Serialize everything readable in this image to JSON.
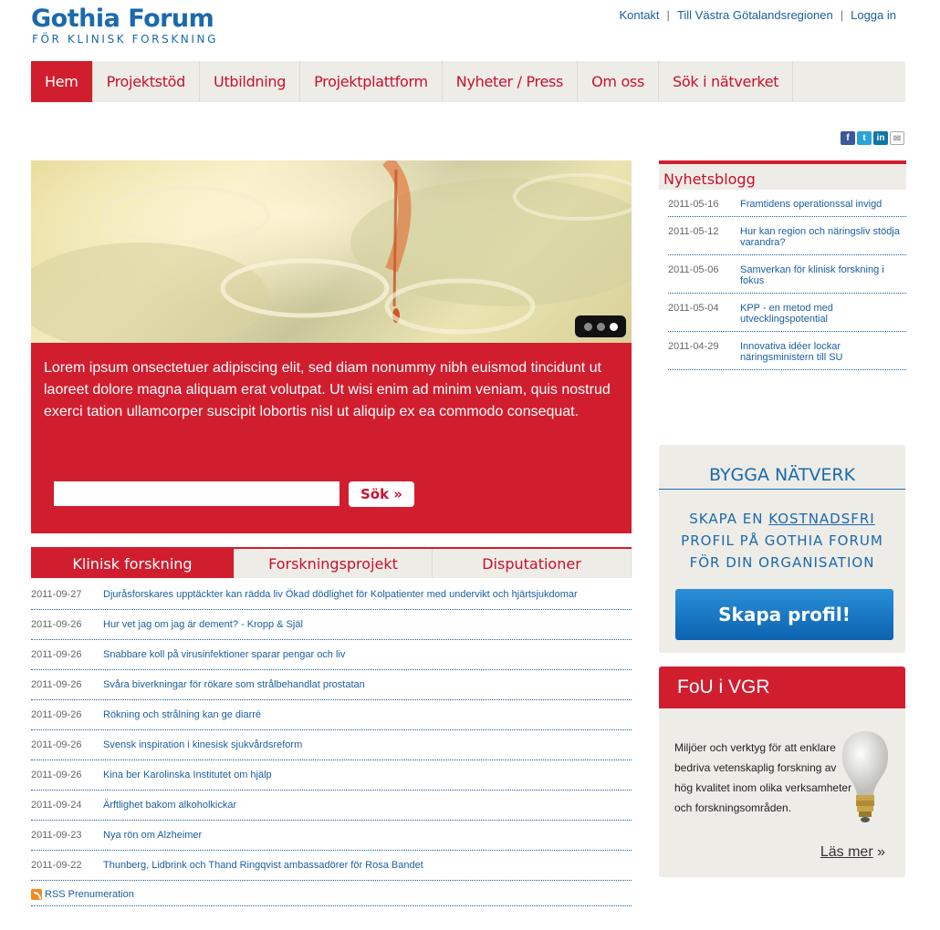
{
  "header": {
    "logo_main": "Gothia Forum",
    "logo_sub": "FÖR KLINISK FORSKNING",
    "links": [
      "Kontakt",
      "Till Västra Götalandsregionen",
      "Logga in"
    ]
  },
  "nav": [
    "Hem",
    "Projektstöd",
    "Utbildning",
    "Projektplattform",
    "Nyheter / Press",
    "Om oss",
    "Sök i nätverket"
  ],
  "social": [
    "facebook-icon",
    "twitter-icon",
    "linkedin-icon",
    "mail-icon"
  ],
  "hero": {
    "text": "Lorem ipsum onsectetuer adipiscing elit, sed diam nonummy nibh euismod tincidunt ut laoreet dolore magna aliquam erat volutpat. Ut wisi enim ad minim veniam, quis nostrud exerci tation ullamcorper suscipit lobortis nisl ut aliquip ex ea commodo consequat.",
    "search_placeholder": "",
    "search_button": "Sök »",
    "slides": 3,
    "active_slide": 3
  },
  "tabs": [
    "Klinisk forskning",
    "Forskningsprojekt",
    "Disputationer"
  ],
  "news": [
    {
      "date": "2011-09-27",
      "title": "Djuråsforskares upptäckter kan rädda liv Ökad dödlighet för Kolpatienter med undervikt och hjärtsjukdomar"
    },
    {
      "date": "2011-09-26",
      "title": "Hur vet jag om jag är dement? - Kropp & Själ"
    },
    {
      "date": "2011-09-26",
      "title": "Snabbare koll på virusinfektioner sparar pengar och liv"
    },
    {
      "date": "2011-09-26",
      "title": "Svåra biverkningar för rökare som strålbehandlat prostatan"
    },
    {
      "date": "2011-09-26",
      "title": "Rökning och strålning kan ge diarré"
    },
    {
      "date": "2011-09-26",
      "title": "Svensk inspiration i kinesisk sjukvårdsreform"
    },
    {
      "date": "2011-09-26",
      "title": "Kina ber Karolinska Institutet om hjälp"
    },
    {
      "date": "2011-09-24",
      "title": "Ärftlighet bakom alkoholkickar"
    },
    {
      "date": "2011-09-23",
      "title": "Nya rön om Alzheimer"
    },
    {
      "date": "2011-09-22",
      "title": "Thunberg, Lidbrink och Thand Ringqvist ambassadörer för Rosa Bandet"
    }
  ],
  "rss_label": "RSS Prenumeration",
  "blog": {
    "title": "Nyhetsblogg",
    "items": [
      {
        "date": "2011-05-16",
        "title": "Framtidens operationssal invigd"
      },
      {
        "date": "2011-05-12",
        "title": "Hur kan region och näringsliv stödja varandra?"
      },
      {
        "date": "2011-05-06",
        "title": "Samverkan för klinisk forskning i fokus"
      },
      {
        "date": "2011-05-04",
        "title": "KPP - en metod med utvecklingspotential"
      },
      {
        "date": "2011-04-29",
        "title": "Innovativa idéer lockar näringsministern till SU"
      }
    ]
  },
  "bygg": {
    "title": "BYGGA NÄTVERK",
    "line1_a": "SKAPA EN ",
    "line1_b": "KOSTNADSFRI",
    "line2": "PROFIL PÅ GOTHIA FORUM",
    "line3": "FÖR DIN ORGANISATION",
    "button": "Skapa profil!"
  },
  "fou": {
    "title": "FoU i VGR",
    "text": "Miljöer och verktyg för att enklare bedriva vetenskaplig forskning av hög kvalitet inom olika verksamheter och forskningsområden.",
    "more": "Läs mer",
    "more_suffix": " »"
  },
  "colors": {
    "brand_red": "#d11e2f",
    "brand_blue": "#1a6aad",
    "link": "#1a5fa0",
    "nav_bg": "#eeece6"
  }
}
